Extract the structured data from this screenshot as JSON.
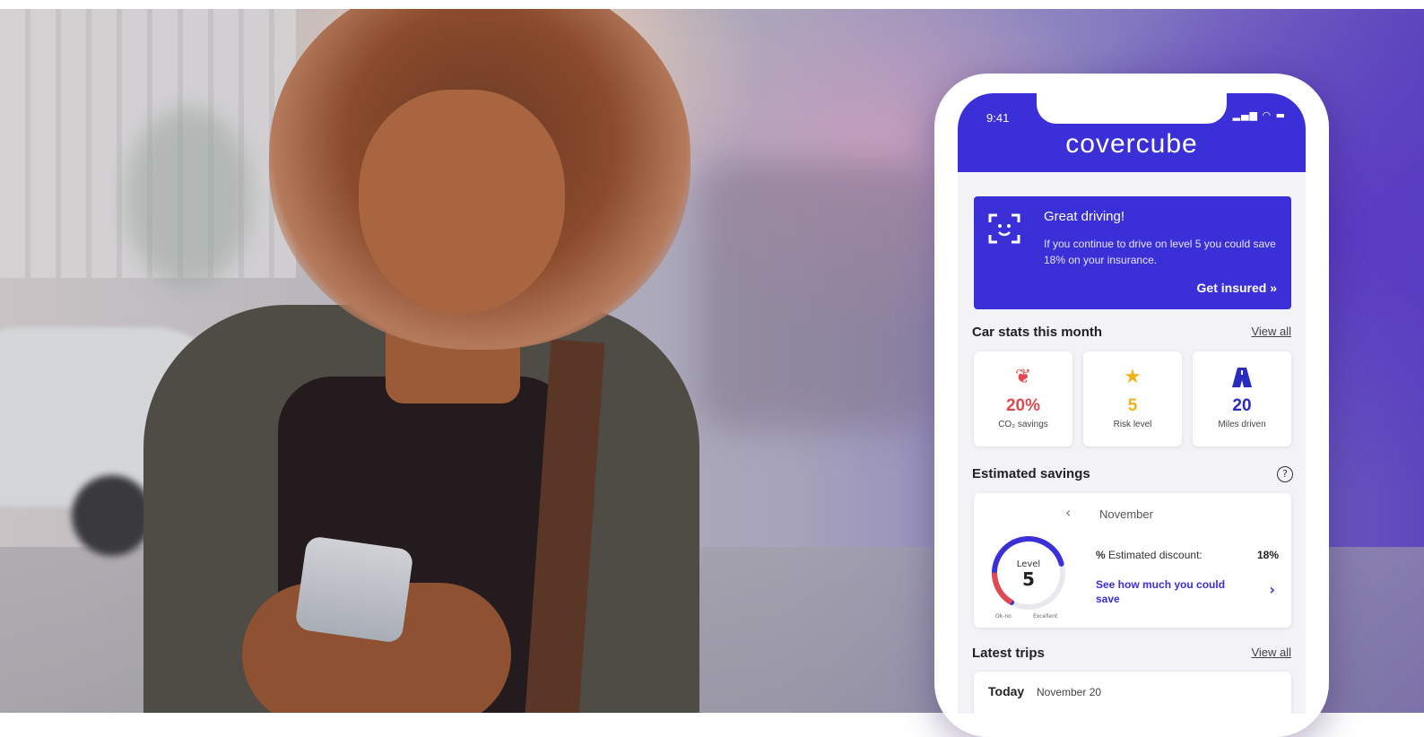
{
  "colors": {
    "brand": "#3b2fd8",
    "co2": "#e0494f",
    "risk": "#f2b21b",
    "miles": "#2a2bbf"
  },
  "status_bar": {
    "time": "9:41",
    "icons": "signal-wifi-battery"
  },
  "app": {
    "brand": "covercube"
  },
  "banner": {
    "icon": "scan-face-icon",
    "title": "Great driving!",
    "text": "If you continue to drive on level 5 you could save 18% on your insurance.",
    "cta": "Get insured »"
  },
  "car_stats": {
    "title": "Car stats this month",
    "view_all": "View all",
    "items": [
      {
        "icon": "leaf-icon",
        "value": "20%",
        "label": "CO₂ savings"
      },
      {
        "icon": "star-icon",
        "value": "5",
        "label": "Risk level"
      },
      {
        "icon": "road-icon",
        "value": "20",
        "label": "Miles driven"
      }
    ]
  },
  "savings": {
    "title": "Estimated savings",
    "month": "November",
    "gauge": {
      "label": "Level",
      "value": "5",
      "low": "Ok-no",
      "high": "Excellent",
      "fill": 0.75
    },
    "discount_label": "Estimated discount:",
    "discount_value": "18%",
    "see_link": "See how much you could save"
  },
  "trips": {
    "title": "Latest trips",
    "view_all": "View all",
    "day": "Today",
    "date": "November 20"
  }
}
